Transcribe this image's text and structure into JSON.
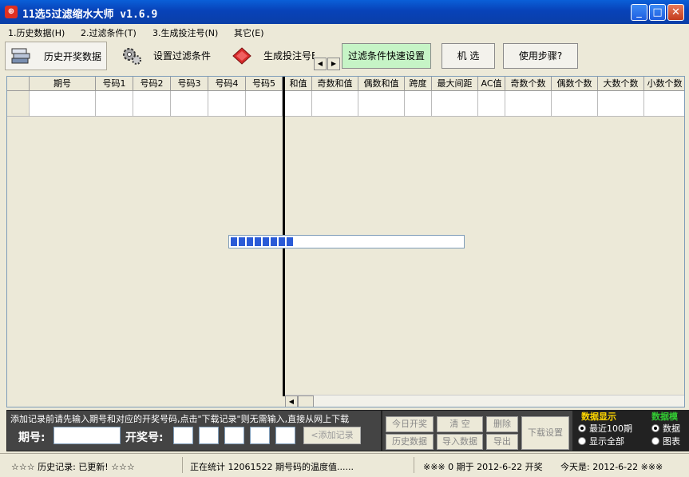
{
  "window": {
    "title": "11选5过滤缩水大师 v1.6.9",
    "app_icon": "app-logo-icon",
    "controls": [
      "minimize-icon",
      "maximize-icon",
      "close-icon"
    ]
  },
  "menu": [
    "1.历史数据(H)",
    "2.过滤条件(T)",
    "3.生成投注号(N)",
    "其它(E)"
  ],
  "toolbar": {
    "history_label": "历史开奖数据",
    "filter_label": "设置过滤条件",
    "generate_label": "生成投注号E",
    "quick_filter_label": "过滤条件快速设置",
    "random_label": "机 选",
    "help_label": "使用步骤?"
  },
  "grid": {
    "left_columns": [
      "期号",
      "号码1",
      "号码2",
      "号码3",
      "号码4",
      "号码5"
    ],
    "right_columns": [
      "和值",
      "奇数和值",
      "偶数和值",
      "跨度",
      "最大间距",
      "AC值",
      "奇数个数",
      "偶数个数",
      "大数个数",
      "小数个数"
    ]
  },
  "progress": {
    "segments_filled": 8
  },
  "input_panel": {
    "hint": "添加记录前请先输入期号和对应的开奖号码,点击\"下载记录\"则无需输入,直接从网上下载",
    "issue_label": "期号:",
    "numbers_label": "开奖号:",
    "issue_value": "",
    "number_values": [
      "",
      "",
      "",
      "",
      ""
    ],
    "add_button": "<添加记录"
  },
  "actions": {
    "today_draw": "今日开奖",
    "clear": "清 空",
    "delete": "删除",
    "history_data": "历史数据",
    "import_data": "导入数据",
    "export": "导出",
    "download_settings": "下载设置"
  },
  "display_group": {
    "title": "数据显示",
    "options": [
      "最近100期",
      "显示全部"
    ],
    "selected": "最近100期"
  },
  "mode_group": {
    "title": "数据模",
    "options": [
      "数据",
      "图表"
    ],
    "selected": "数据"
  },
  "status": {
    "history_record": "☆☆☆  历史记录: 已更新!  ☆☆☆",
    "progress_text": "正在统计 12061522 期号码的温度值......",
    "issue_info": "※※※  0 期于 2012-6-22 开奖",
    "today": "今天是: 2012-6-22 ※※※"
  },
  "colors": {
    "title_bar": "#0a5fd8",
    "window_bg": "#ece9d8",
    "quick_filter_bg": "#c6f4c6",
    "progress_fill": "#2a5bd7",
    "panel_bg": "#444444",
    "display_title": "#ffd700",
    "mode_title": "#33cc33"
  }
}
